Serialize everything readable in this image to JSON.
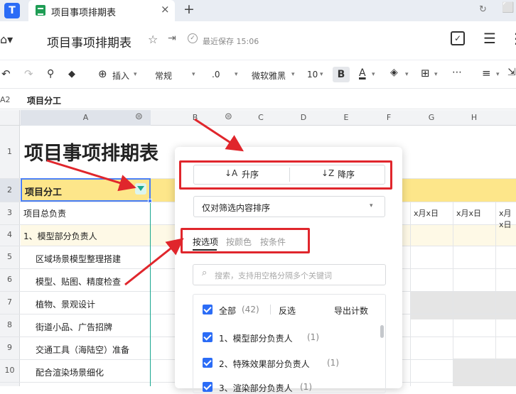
{
  "tab": {
    "title": "项目事项排期表",
    "close": "×",
    "new_tab": "+"
  },
  "header": {
    "doc_title": "项目事项排期表",
    "saved_status": "最近保存 15:06"
  },
  "toolbar": {
    "insert": "插入",
    "format": "常规",
    "decimal": ".0",
    "font_name": "微软雅黑",
    "font_size": "10",
    "bold": "B",
    "text_color": "A"
  },
  "formula_bar": {
    "cell_ref": "A2",
    "content": "项目分工"
  },
  "columns": [
    "A",
    "B",
    "C",
    "D",
    "E",
    "F",
    "G",
    "H"
  ],
  "rows": [
    {
      "num": "1",
      "a": "项目事项排期表"
    },
    {
      "num": "2",
      "a": "项目分工"
    },
    {
      "num": "3",
      "a": "项目总负责"
    },
    {
      "num": "4",
      "a": "1、模型部分负责人"
    },
    {
      "num": "5",
      "a": "区域场景模型整理搭建"
    },
    {
      "num": "6",
      "a": "模型、贴图、精度检查"
    },
    {
      "num": "7",
      "a": "植物、景观设计"
    },
    {
      "num": "8",
      "a": "街道小品、广告招牌"
    },
    {
      "num": "9",
      "a": "交通工具（海陆空）准备"
    },
    {
      "num": "10",
      "a": "配合渲染场景细化"
    }
  ],
  "date_label": "x月x日",
  "filter_popup": {
    "sort_asc": "升序",
    "sort_desc": "降序",
    "sort_scope": "仅对筛选内容排序",
    "tabs": [
      "按选项",
      "按颜色",
      "按条件"
    ],
    "search_placeholder": "搜索，支持用空格分隔多个关键词",
    "select_all": "全部",
    "count": "(42)",
    "invert": "反选",
    "export": "导出计数",
    "items": [
      {
        "label": "1、模型部分负责人",
        "count": "(1)"
      },
      {
        "label": "2、特殊效果部分负责人",
        "count": "(1)"
      },
      {
        "label": "3、渲染部分负责人",
        "count": "(1)"
      }
    ]
  },
  "colors": {
    "accent": "#2b6cf6",
    "highlight_row": "#fde68a",
    "annotation": "#e0262c",
    "filter_icon": "#1aa890"
  }
}
